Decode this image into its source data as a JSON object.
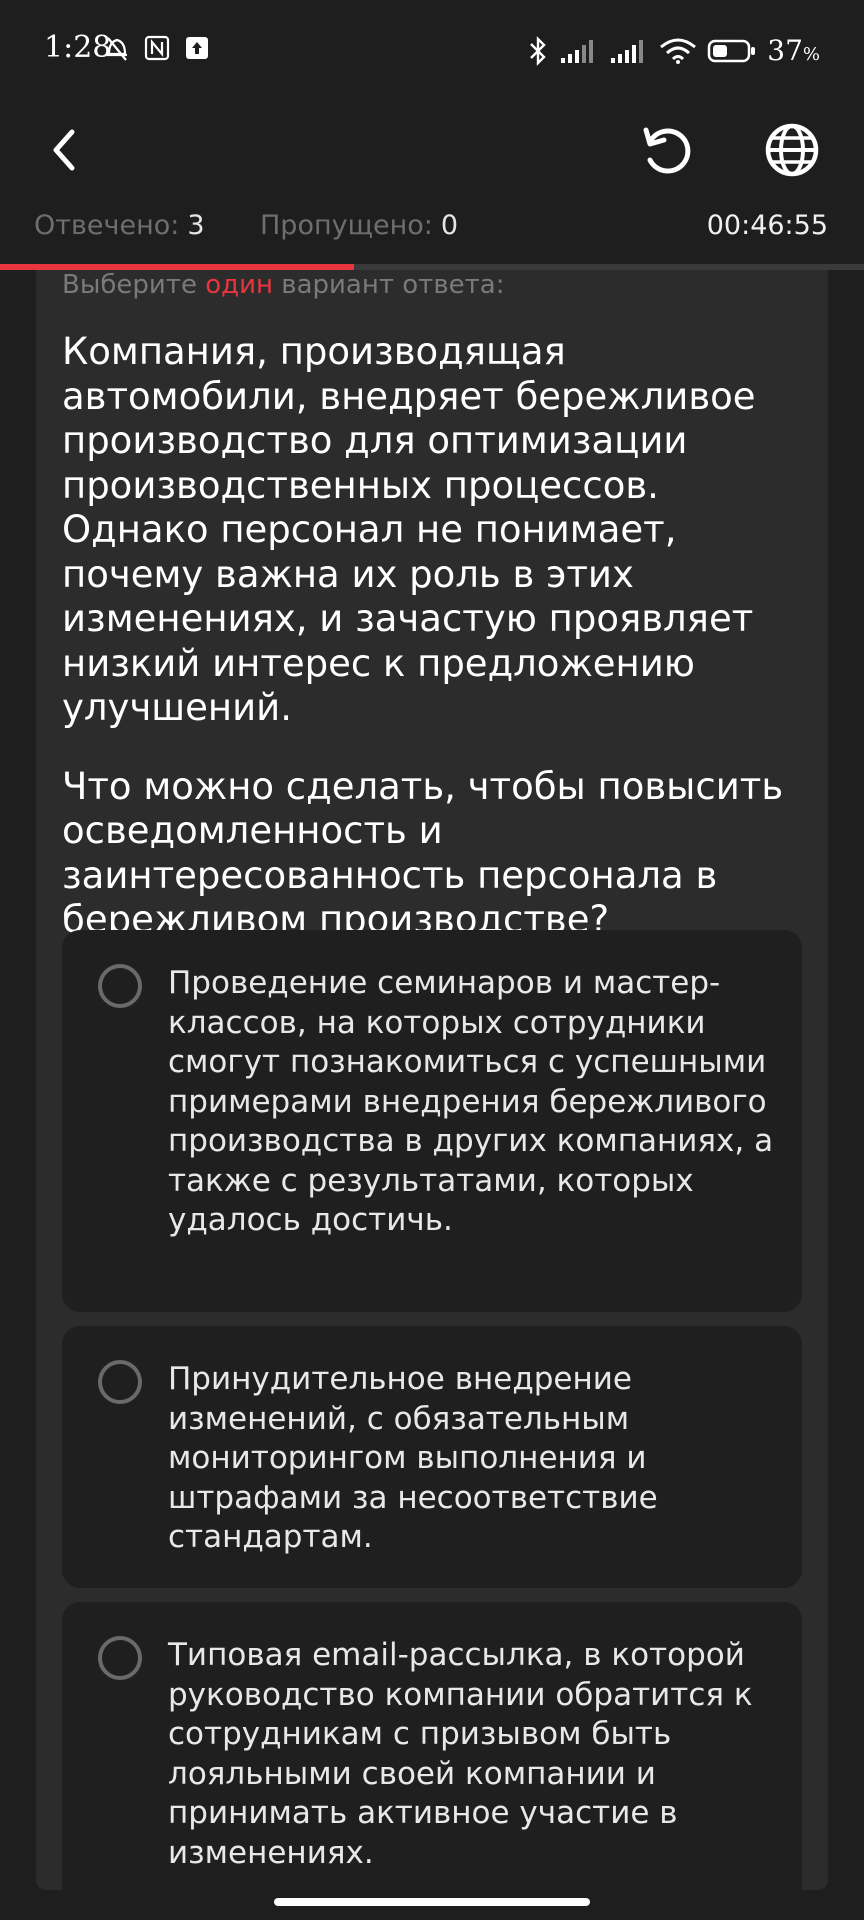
{
  "status_bar": {
    "time": "1:28",
    "battery": "37",
    "battery_unit": "%"
  },
  "stats": {
    "answered_label": "Отвечено:",
    "answered_value": "3",
    "skipped_label": "Пропущено:",
    "skipped_value": "0",
    "timer": "00:46:55",
    "progress_fraction": 0.41
  },
  "instruction": {
    "prefix": "Выберите",
    "accent": "один",
    "suffix": "вариант ответа:"
  },
  "question": {
    "paragraph1": "Компания, производящая автомобили, внедряет бережливое производство для оптимизации производственных процессов. Однако персонал не понимает, почему важна их роль в этих изменениях, и зачастую проявляет низкий интерес к предложению улучшений.",
    "paragraph2": "Что можно сделать, чтобы повысить осведомленность и заинтересованность персонала в бережливом производстве?"
  },
  "options": [
    {
      "text": "Проведение семинаров и мастер-классов, на которых сотрудники смогут познакомиться с успешными примерами внедрения бережливого производства в других компаниях, а также с результатами, которых удалось достичь."
    },
    {
      "text": "Принудительное внедрение изменений, с обязательным мониторингом выполнения и штрафами за несоответствие стандартам."
    },
    {
      "text": "Типовая email-рассылка, в которой руководство компании обратится к сотрудникам с призывом быть лояльными своей компании и принимать активное участие в изменениях."
    }
  ],
  "colors": {
    "accent": "#e8353f",
    "background": "#1e1e1e",
    "card": "#2c2c2c",
    "option": "#1f1f1f"
  },
  "icons": {
    "status_left": [
      "bell-off-icon",
      "nfc-icon",
      "upload-notification-icon"
    ],
    "status_right": [
      "bluetooth-icon",
      "signal-icon",
      "signal-icon",
      "wifi-icon",
      "battery-icon"
    ],
    "toolbar": [
      "chevron-left-icon",
      "reset-icon",
      "globe-icon"
    ]
  }
}
